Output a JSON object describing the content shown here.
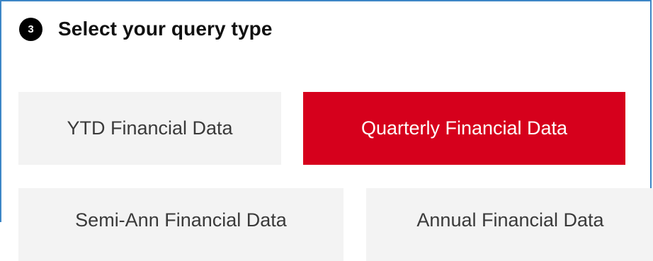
{
  "section": {
    "step_number": "3",
    "title": "Select your query type"
  },
  "options": [
    {
      "label": "YTD Financial Data",
      "selected": false
    },
    {
      "label": "Quarterly Financial Data",
      "selected": true
    },
    {
      "label": "Semi-Ann Financial Data",
      "selected": false
    },
    {
      "label": "Annual Financial Data",
      "selected": false
    }
  ],
  "colors": {
    "frame_border": "#3d86c6",
    "selected_bg": "#d6001c",
    "unselected_bg": "#f3f3f3",
    "badge_bg": "#000000"
  }
}
